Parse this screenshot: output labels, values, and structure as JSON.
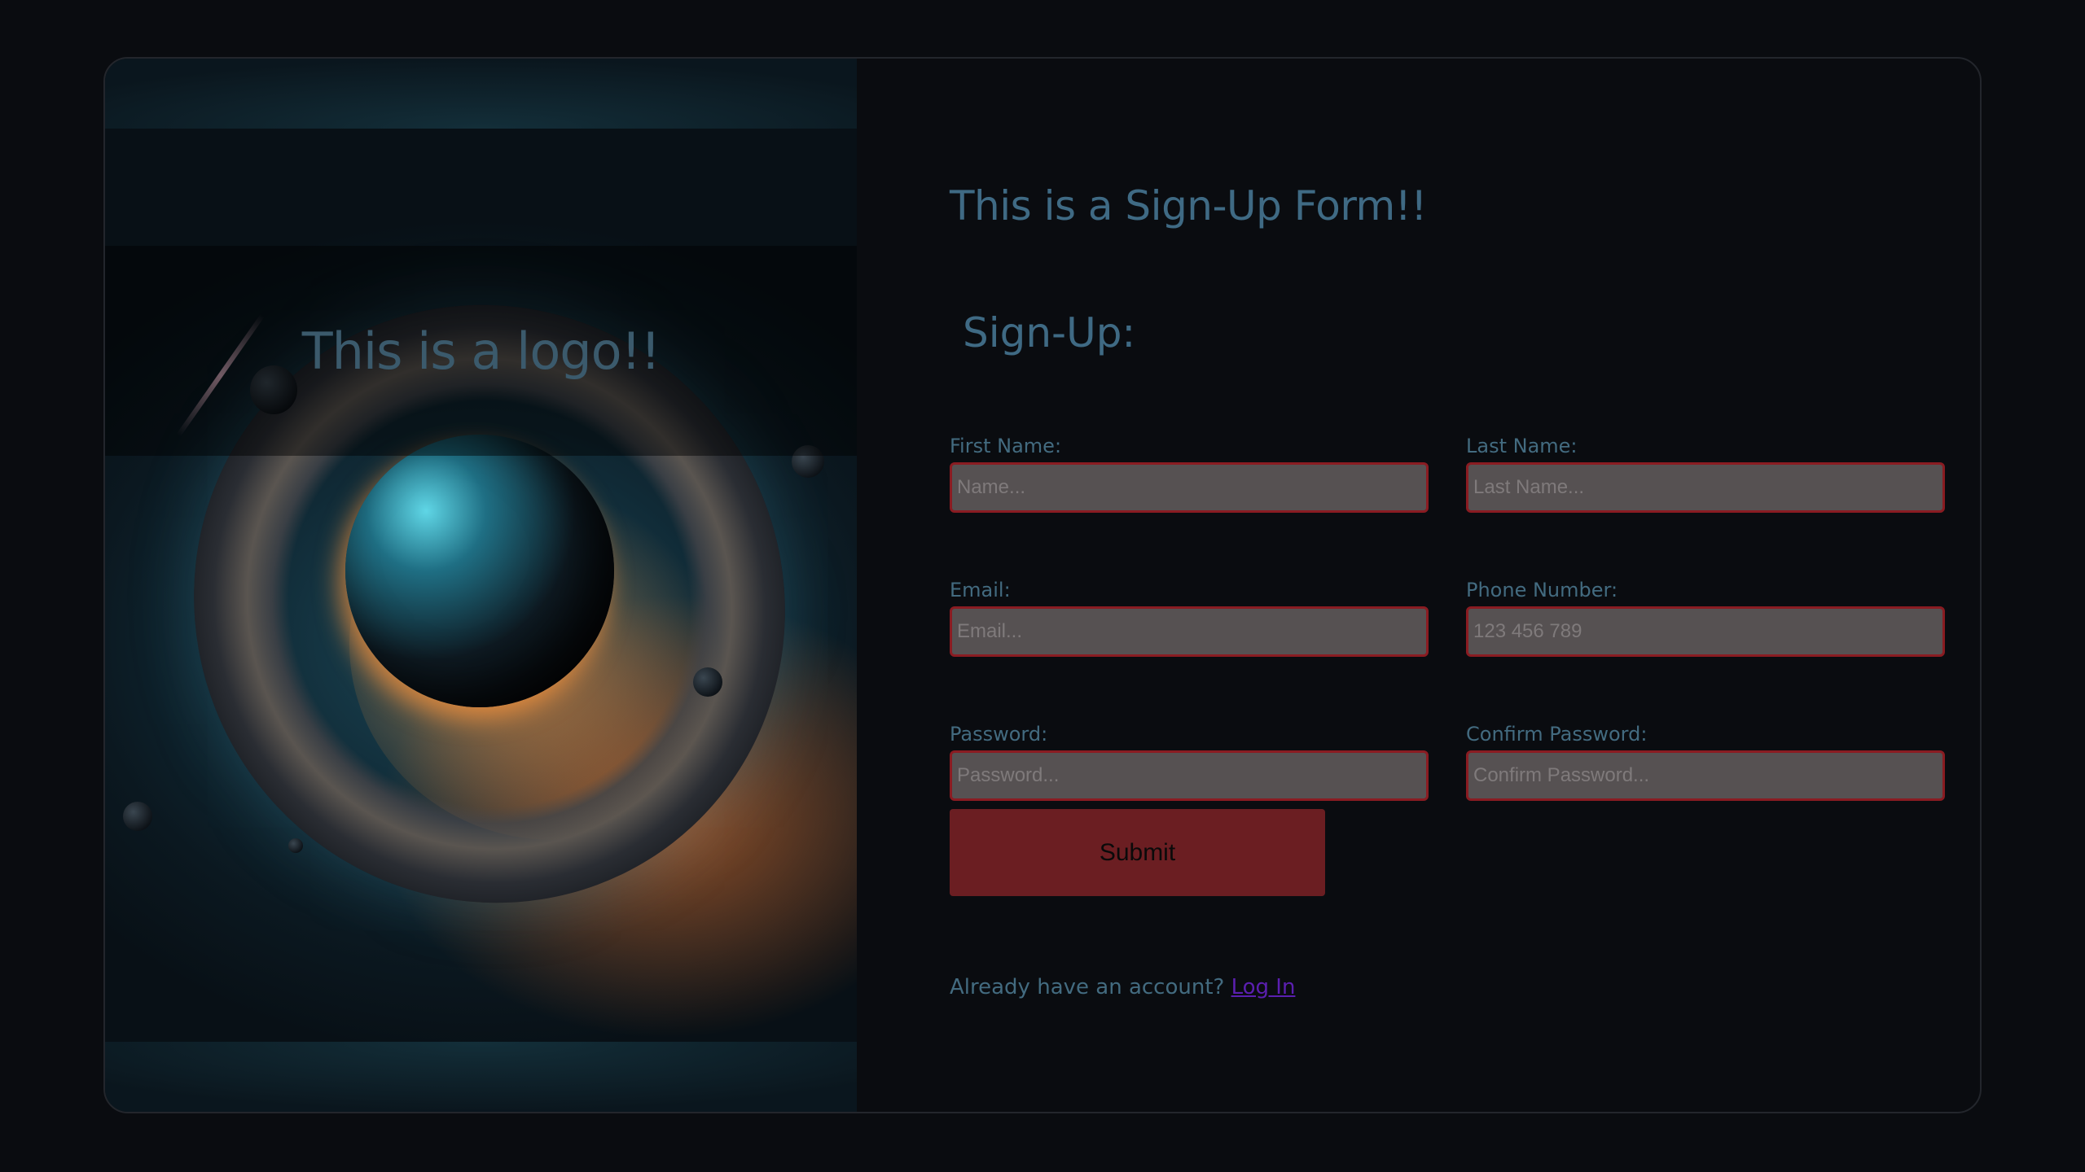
{
  "colors": {
    "background": "#0a0c10",
    "heading_text": "#3f6a84",
    "input_fill": "#565152",
    "input_border": "#8a1c22",
    "submit_fill": "#6b1e22",
    "link": "#5b1fb0"
  },
  "art_panel": {
    "logo_text": "This is a logo!!"
  },
  "form": {
    "heading": "This is a Sign-Up Form!!",
    "subheading": "Sign-Up:",
    "fields": [
      {
        "label": "First Name:",
        "placeholder": "Name..."
      },
      {
        "label": "Last Name:",
        "placeholder": "Last Name..."
      },
      {
        "label": "Email:",
        "placeholder": "Email..."
      },
      {
        "label": "Phone Number:",
        "placeholder": "123 456 789"
      },
      {
        "label": "Password:",
        "placeholder": "Password..."
      },
      {
        "label": "Confirm Password:",
        "placeholder": "Confirm Password..."
      }
    ],
    "submit_label": "Submit",
    "login_prompt": "Already have an account?",
    "login_link": "Log In"
  }
}
